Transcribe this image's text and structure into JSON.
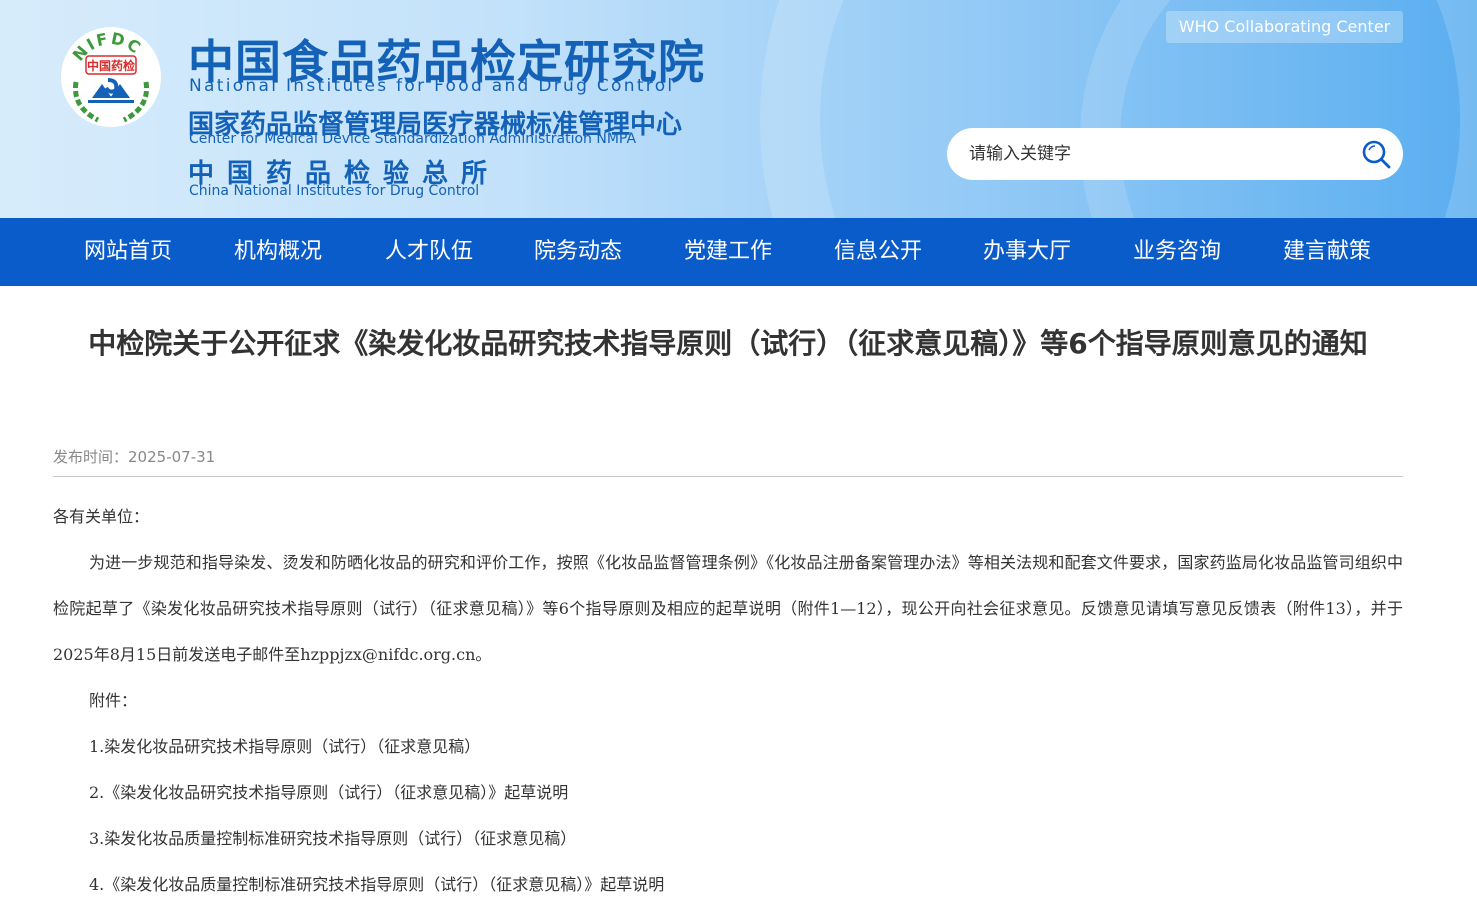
{
  "header": {
    "logo_text": "NIFDC",
    "logo_inner": "中国药检",
    "brand_cn1": "中国食品药品检定研究院",
    "brand_en1": "National Institutes for Food and Drug Control",
    "brand_cn2": "国家药品监督管理局医疗器械标准管理中心",
    "brand_en2": "Center for Medical Device Standardization Administration NMPA",
    "brand_cn3": "中国药品检验总所",
    "brand_en3": "China National Institutes for Drug Control",
    "who_label": "WHO Collaborating Center",
    "search_placeholder": "请输入关键字"
  },
  "nav": {
    "items": [
      "网站首页",
      "机构概况",
      "人才队伍",
      "院务动态",
      "党建工作",
      "信息公开",
      "办事大厅",
      "业务咨询",
      "建言献策"
    ]
  },
  "article": {
    "title": "中检院关于公开征求《染发化妆品研究技术指导原则（试行）（征求意见稿）》等6个指导原则意见的通知",
    "date_label": "发布时间：",
    "date": "2025-07-31",
    "greeting": "各有关单位：",
    "paragraph": "为进一步规范和指导染发、烫发和防晒化妆品的研究和评价工作，按照《化妆品监督管理条例》《化妆品注册备案管理办法》等相关法规和配套文件要求，国家药监局化妆品监管司组织中检院起草了《染发化妆品研究技术指导原则（试行）（征求意见稿）》等6个指导原则及相应的起草说明（附件1—12），现公开向社会征求意见。反馈意见请填写意见反馈表（附件13），并于2025年8月15日前发送电子邮件至hzppjzx@nifdc.org.cn。",
    "attachments_label": "附件：",
    "attachments": [
      "1.染发化妆品研究技术指导原则（试行）（征求意见稿）",
      "2.《染发化妆品研究技术指导原则（试行）（征求意见稿）》起草说明",
      "3.染发化妆品质量控制标准研究技术指导原则（试行）（征求意见稿）",
      "4.《染发化妆品质量控制标准研究技术指导原则（试行）（征求意见稿）》起草说明"
    ]
  },
  "colors": {
    "nav_bg": "#0b5ccb",
    "brand_blue": "#1462b8",
    "logo_green": "#3c9a3c",
    "logo_red": "#d92b2b"
  }
}
